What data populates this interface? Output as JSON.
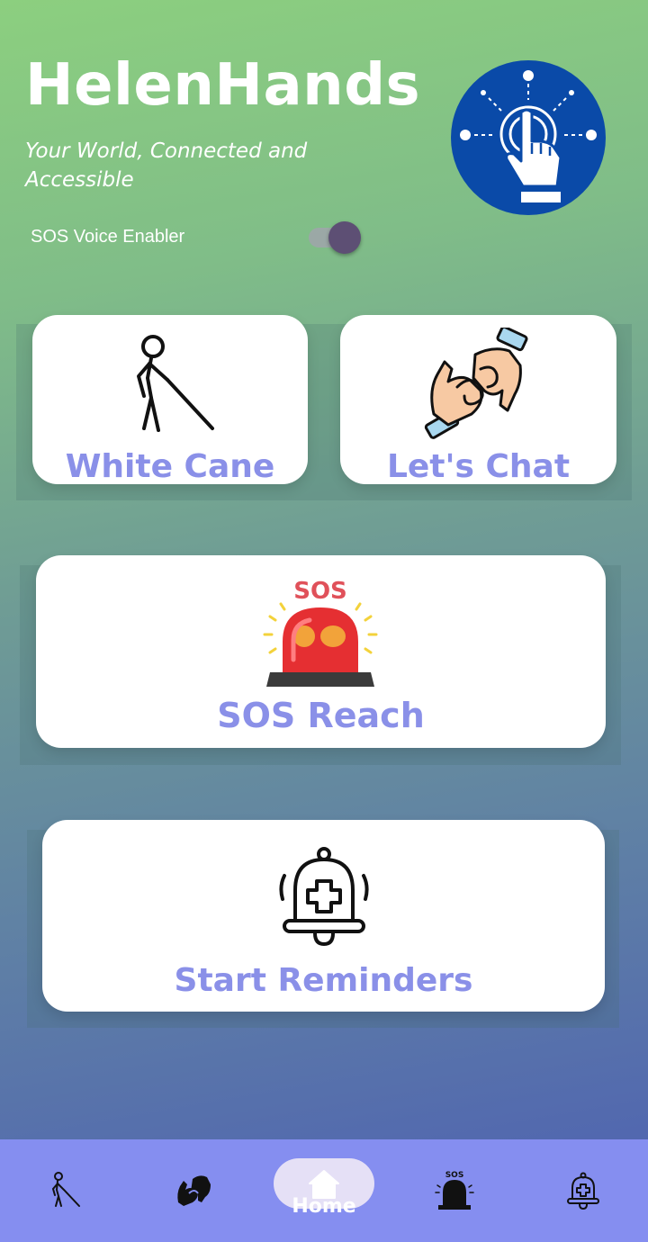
{
  "header": {
    "title": "HelenHands",
    "tagline": "Your World, Connected and Accessible",
    "logo_icon": "tap-hand-icon"
  },
  "sos_voice": {
    "label": "SOS Voice Enabler",
    "enabled": true
  },
  "cards": [
    {
      "label": "White Cane",
      "icon": "white-cane-person-icon"
    },
    {
      "label": "Let's Chat",
      "icon": "sign-language-hands-icon"
    },
    {
      "label": "SOS Reach",
      "icon": "sos-siren-icon",
      "badge": "SOS"
    },
    {
      "label": "Start Reminders",
      "icon": "medical-bell-icon"
    }
  ],
  "bottom_nav": {
    "items": [
      {
        "icon": "white-cane-person-icon"
      },
      {
        "icon": "sign-language-hands-icon"
      },
      {
        "icon": "home-icon",
        "label": "Home",
        "active": true
      },
      {
        "icon": "sos-siren-icon",
        "badge": "SOS"
      },
      {
        "icon": "medical-bell-icon"
      }
    ]
  },
  "colors": {
    "accent_label": "#8a90e8",
    "nav_background": "#858ef0",
    "logo_background": "#0a4aa8",
    "siren_red": "#e52f32"
  }
}
